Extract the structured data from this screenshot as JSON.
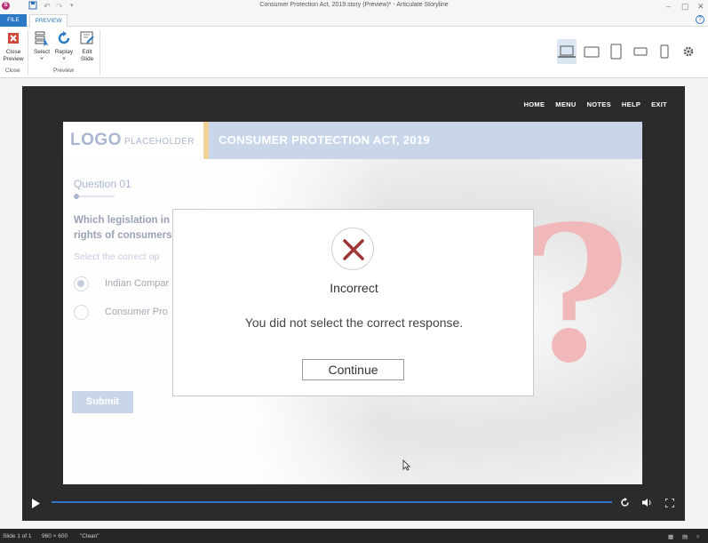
{
  "window": {
    "title": "Consumer Protection Act, 2019.story (Preview)* - Articulate Storyline",
    "app_icon_letter": "S",
    "controls": [
      "–",
      "▢",
      "✕"
    ]
  },
  "ribbon": {
    "tabs": [
      {
        "label": "FILE"
      },
      {
        "label": "PREVIEW"
      }
    ],
    "help": "?",
    "buttons": {
      "close_preview": "Close Preview",
      "select": "Select",
      "replay": "Replay",
      "edit_slide": "Edit Slide"
    },
    "groups": {
      "close": "Close",
      "preview": "Preview"
    },
    "accent_color": "#2b78c5",
    "close_color": "#d0473a"
  },
  "player": {
    "nav": [
      "HOME",
      "MENU",
      "NOTES",
      "HELP",
      "EXIT"
    ],
    "seek_color": "#2f77c6"
  },
  "slide": {
    "logo": "LOGO",
    "logo_placeholder": "PLACEHOLDER",
    "course_title": "CONSUMER PROTECTION ACT, 2019",
    "question_number": "Question 01",
    "question_line1": "Which legislation in I",
    "question_line2": "rights of consumers?",
    "instruction": "Select the correct op",
    "options": [
      {
        "label": "Indian Compar",
        "selected": true
      },
      {
        "label": "Consumer Pro",
        "selected": false
      }
    ],
    "submit": "Submit"
  },
  "modal": {
    "title": "Incorrect",
    "message": "You did not select the correct response.",
    "continue": "Continue",
    "icon_color": "#9e3535"
  },
  "status": {
    "slide": "Slide 1 of 1",
    "size": "960 × 600",
    "theme": "\"Clean\""
  }
}
